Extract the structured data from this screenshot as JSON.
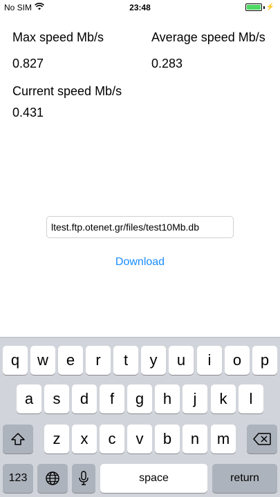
{
  "status_bar": {
    "carrier": "No SIM",
    "time": "23:48",
    "battery_color": "#4cd964",
    "wifi_icon": "wifi-icon",
    "battery_icon": "battery-charging-icon"
  },
  "stats": {
    "max_label": "Max speed Mb/s",
    "max_value": "0.827",
    "avg_label": "Average speed Mb/s",
    "avg_value": "0.283",
    "current_label": "Current speed Mb/s",
    "current_value": "0.431"
  },
  "url_field": {
    "value": "ltest.ftp.otenet.gr/files/test10Mb.db"
  },
  "download_label": "Download",
  "accent_color": "#1a8cff",
  "keyboard": {
    "row1": [
      "q",
      "w",
      "e",
      "r",
      "t",
      "y",
      "u",
      "i",
      "o",
      "p"
    ],
    "row2": [
      "a",
      "s",
      "d",
      "f",
      "g",
      "h",
      "j",
      "k",
      "l"
    ],
    "row3": [
      "z",
      "x",
      "c",
      "v",
      "b",
      "n",
      "m"
    ],
    "numbers_label": "123",
    "space_label": "space",
    "return_label": "return",
    "shift_icon": "shift-icon",
    "backspace_icon": "backspace-icon",
    "globe_icon": "globe-icon",
    "mic_icon": "microphone-icon"
  }
}
